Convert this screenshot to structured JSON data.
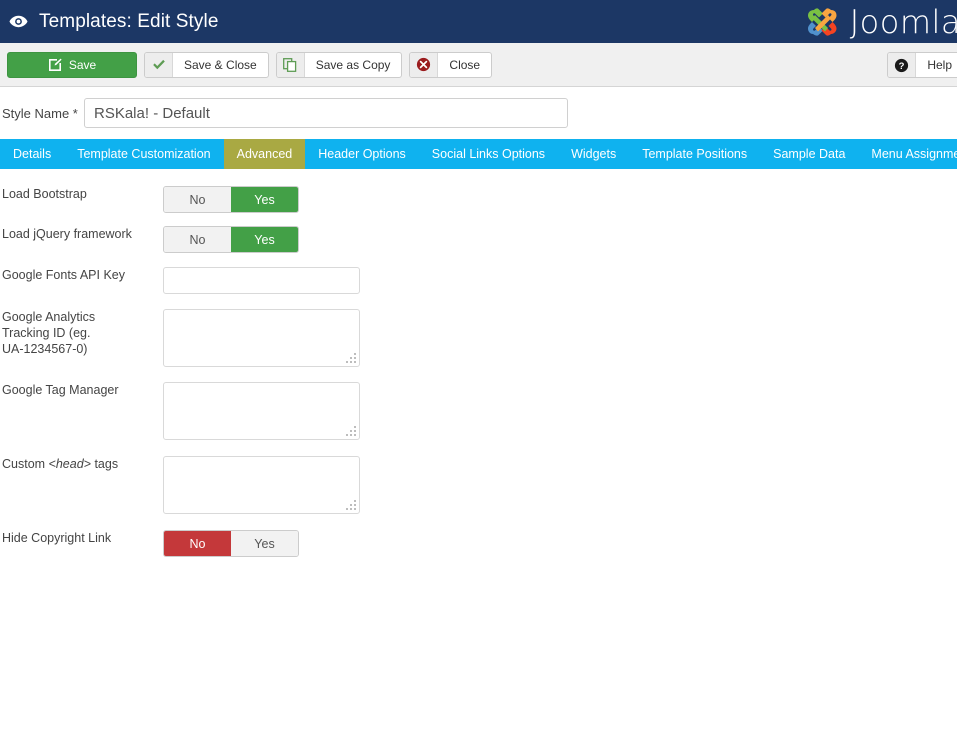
{
  "header": {
    "icon": "eye-icon",
    "title": "Templates: Edit Style",
    "brand": "Joomla",
    "brand_mark": "joomla-logo-icon",
    "bg_color": "#1c3765"
  },
  "toolbar": {
    "save_label": "Save",
    "save_icon": "edit-pencil-icon",
    "save_close_label": "Save & Close",
    "save_close_icon": "check-icon",
    "save_copy_label": "Save as Copy",
    "save_copy_icon": "copy-icon",
    "close_label": "Close",
    "close_icon": "close-circle-icon",
    "help_label": "Help",
    "help_icon": "question-circle-icon",
    "save_color": "#43a047"
  },
  "style_name": {
    "label": "Style Name *",
    "value": "RSKala! - Default",
    "placeholder": ""
  },
  "tabs": {
    "active_color": "#a9a943",
    "bar_color": "#0fb2ef",
    "items": [
      {
        "label": "Details",
        "active": false
      },
      {
        "label": "Template Customization",
        "active": false
      },
      {
        "label": "Advanced",
        "active": true
      },
      {
        "label": "Header Options",
        "active": false
      },
      {
        "label": "Social Links Options",
        "active": false
      },
      {
        "label": "Widgets",
        "active": false
      },
      {
        "label": "Template Positions",
        "active": false
      },
      {
        "label": "Sample Data",
        "active": false
      },
      {
        "label": "Menu Assignment",
        "active": false
      }
    ]
  },
  "form": {
    "load_bootstrap": {
      "label": "Load Bootstrap",
      "no_label": "No",
      "yes_label": "Yes",
      "selected": "Yes"
    },
    "load_jquery": {
      "label": "Load jQuery framework",
      "no_label": "No",
      "yes_label": "Yes",
      "selected": "Yes"
    },
    "google_fonts_api_key": {
      "label": "Google Fonts API Key",
      "value": "",
      "placeholder": ""
    },
    "google_analytics": {
      "label_line1": "Google Analytics",
      "label_line2": "Tracking ID (eg.",
      "label_line3": "UA-1234567-0)",
      "value": "",
      "placeholder": ""
    },
    "google_tag_manager": {
      "label": "Google Tag Manager",
      "value": "",
      "placeholder": ""
    },
    "custom_head_tags": {
      "label_before": "Custom ",
      "label_italic": "<head>",
      "label_after": " tags",
      "value": "",
      "placeholder": ""
    },
    "hide_copyright_link": {
      "label": "Hide Copyright Link",
      "no_label": "No",
      "yes_label": "Yes",
      "selected": "No"
    }
  }
}
